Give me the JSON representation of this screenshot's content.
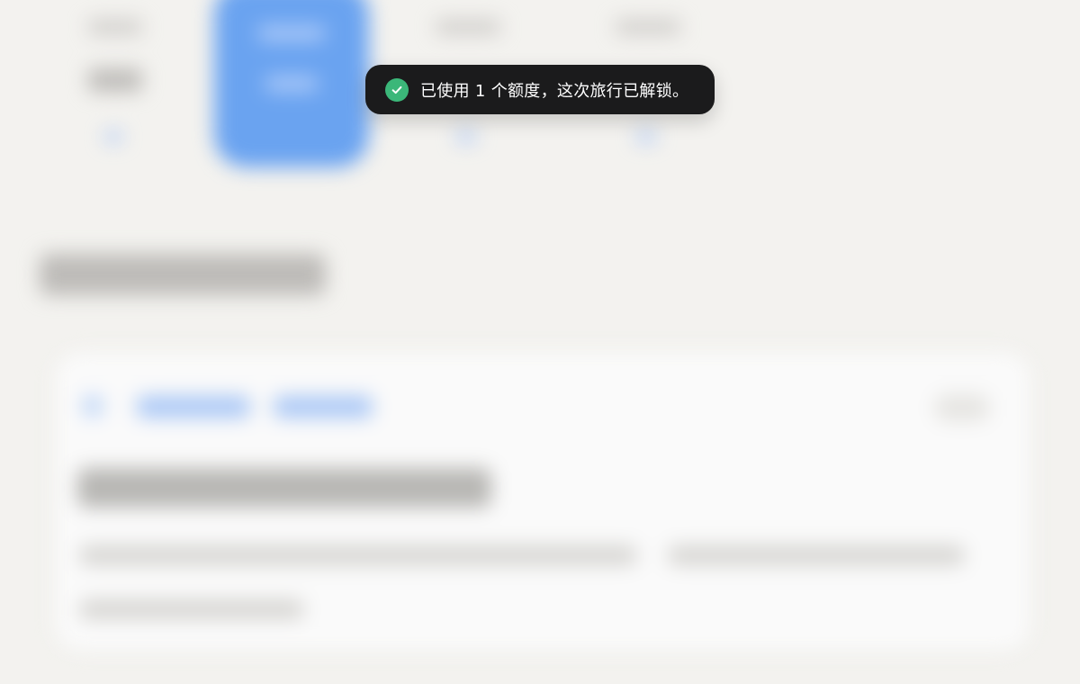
{
  "toast": {
    "message": "已使用 1 个额度，这次旅行已解锁。",
    "icon": "check-circle-icon",
    "icon_color": "#3bb779",
    "background": "#1b1b1c"
  },
  "colors": {
    "page_background": "#f3f2ef",
    "accent": "#6aa3f0"
  }
}
